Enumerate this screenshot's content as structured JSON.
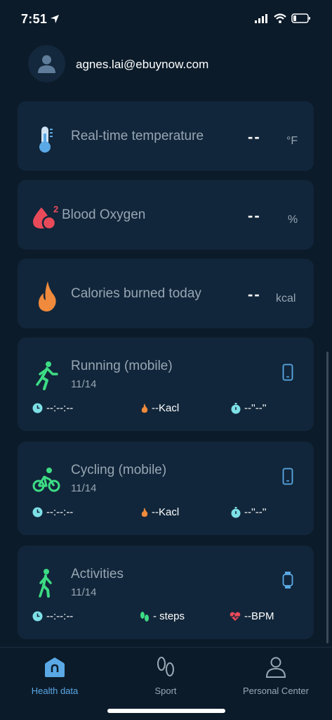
{
  "status_bar": {
    "time": "7:51"
  },
  "account": {
    "email": "agnes.lai@ebuynow.com"
  },
  "metrics": [
    {
      "label": "Real-time temperature",
      "value": "--",
      "unit": "°F",
      "icon": "thermometer-icon"
    },
    {
      "label": "Blood Oxygen",
      "value": "--",
      "unit": "%",
      "icon": "blood-oxygen-icon",
      "superscript": "2"
    },
    {
      "label": "Calories burned today",
      "value": "--",
      "unit": "kcal",
      "icon": "flame-icon"
    }
  ],
  "activities": [
    {
      "title": "Running (mobile)",
      "date": "11/14",
      "icon": "running-icon",
      "device": "phone-icon",
      "stats": [
        "--:--:--",
        "--Kacl",
        "--''--''"
      ]
    },
    {
      "title": "Cycling (mobile)",
      "date": "11/14",
      "icon": "cycling-icon",
      "device": "phone-icon",
      "stats": [
        "--:--:--",
        "--Kacl",
        "--''--''"
      ]
    },
    {
      "title": "Activities",
      "date": "11/14",
      "icon": "walking-icon",
      "device": "watch-icon",
      "stats": [
        "--:--:--",
        "- steps",
        "--BPM"
      ]
    }
  ],
  "tabs": [
    {
      "label": "Health data",
      "active": true
    },
    {
      "label": "Sport",
      "active": false
    },
    {
      "label": "Personal Center",
      "active": false
    }
  ],
  "colors": {
    "background": "#0c1b2a",
    "card": "#11263a",
    "accent_green": "#3ddc84",
    "accent_blue": "#5aa9e6",
    "flame": "#f08a3c",
    "heart": "#e84a5a"
  }
}
